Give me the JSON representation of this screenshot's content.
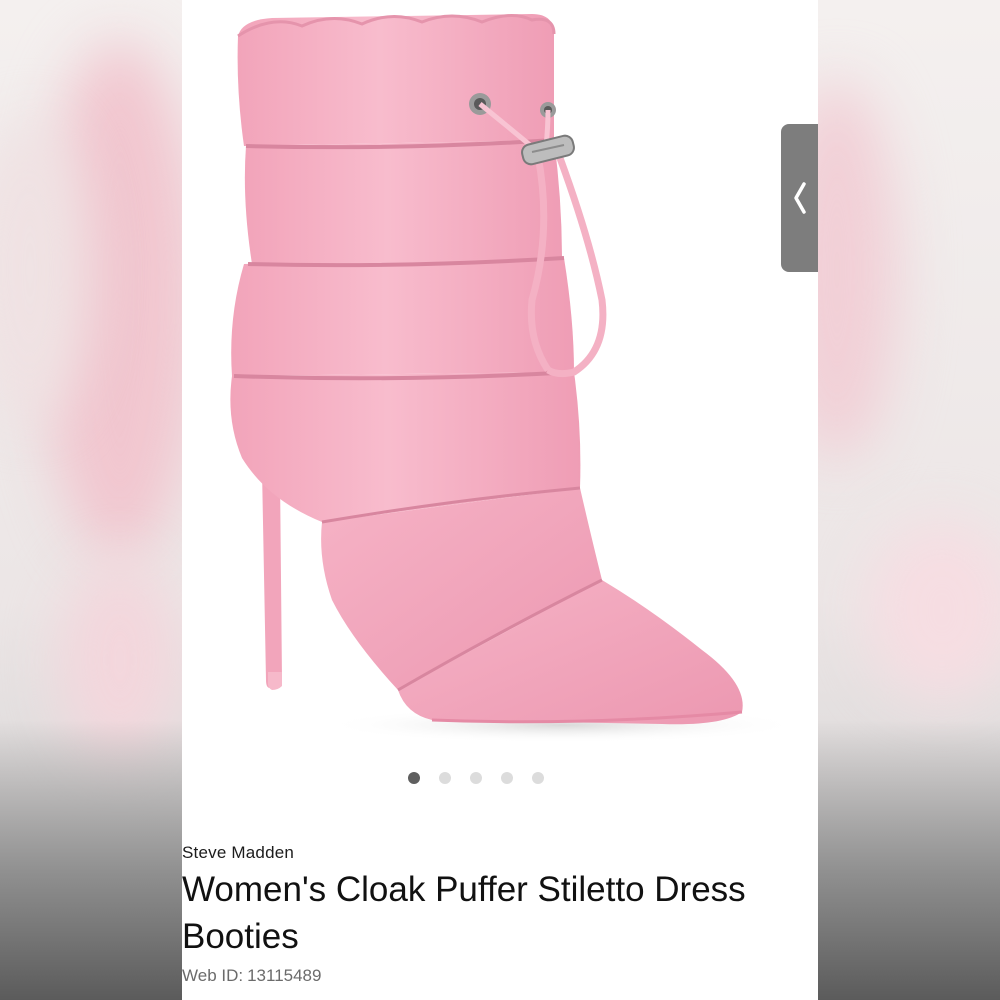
{
  "product": {
    "brand": "Steve Madden",
    "title": "Women's Cloak Puffer Stiletto Dress Booties",
    "web_id_label": "Web ID:",
    "web_id_value": "13115489",
    "image_alt": "Pink puffer stiletto ankle bootie with drawstring",
    "colors": {
      "boot_pink": "#f4aac0",
      "boot_shadow": "#e08fa8",
      "metal": "#b9b9b9"
    }
  },
  "carousel": {
    "dot_count": 5,
    "active_index": 0
  },
  "drawer": {
    "icon": "chevron-left-icon"
  }
}
